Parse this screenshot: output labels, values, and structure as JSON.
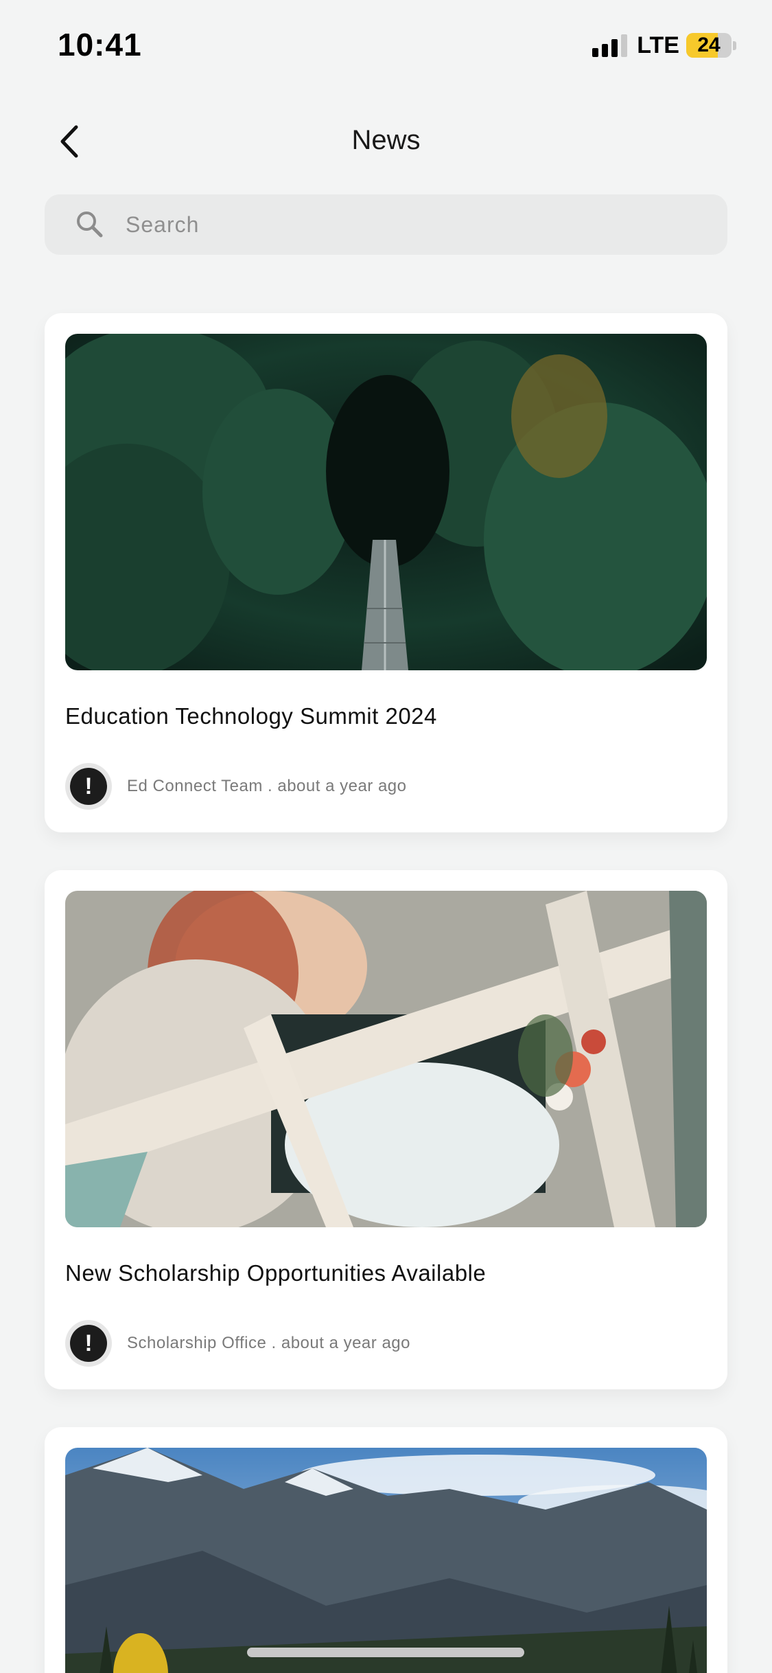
{
  "status_bar": {
    "time": "10:41",
    "network": "LTE",
    "battery": "24"
  },
  "header": {
    "title": "News"
  },
  "search": {
    "placeholder": "Search",
    "value": ""
  },
  "articles": [
    {
      "title": "Education Technology Summit 2024",
      "author": "Ed Connect Team",
      "separator": ".",
      "time": "about a year ago",
      "avatar_icon": "exclamation-icon",
      "image": "forest-bridge-photo"
    },
    {
      "title": "New Scholarship Opportunities Available",
      "author": "Scholarship Office",
      "separator": ".",
      "time": "about a year ago",
      "avatar_icon": "exclamation-icon",
      "image": "wedding-car-photo"
    },
    {
      "title": "",
      "author": "",
      "separator": "",
      "time": "",
      "avatar_icon": "",
      "image": "mountain-landscape-photo"
    }
  ]
}
